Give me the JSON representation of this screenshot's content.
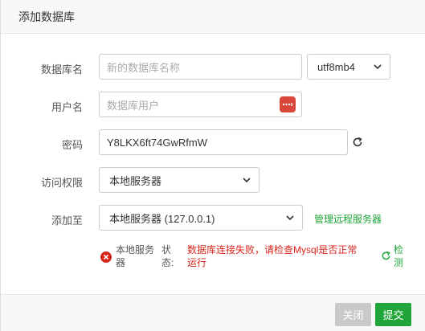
{
  "dialog": {
    "title": "添加数据库"
  },
  "form": {
    "db_name": {
      "label": "数据库名",
      "placeholder": "新的数据库名称",
      "value": ""
    },
    "charset": {
      "value": "utf8mb4"
    },
    "username": {
      "label": "用户名",
      "placeholder": "数据库用户",
      "value": ""
    },
    "password": {
      "label": "密码",
      "value": "Y8LKX6ft74GwRfmW"
    },
    "access": {
      "label": "访问权限",
      "value": "本地服务器"
    },
    "add_to": {
      "label": "添加至",
      "value": "本地服务器 (127.0.0.1)",
      "manage_link": "管理远程服务器"
    }
  },
  "status": {
    "server_line1": "本地服务",
    "server_line2": "器",
    "state_line1": "状",
    "state_line2": "态:",
    "error_line1": "数据库连接失败，请检查Mysql是否正常",
    "error_line2": "运行",
    "check_line1": "检",
    "check_line2": "测"
  },
  "footer": {
    "close_label": "关闭",
    "submit_label": "提交"
  },
  "colors": {
    "green": "#20a53a",
    "red": "#d9251c",
    "password_manager": "#d9473b"
  }
}
